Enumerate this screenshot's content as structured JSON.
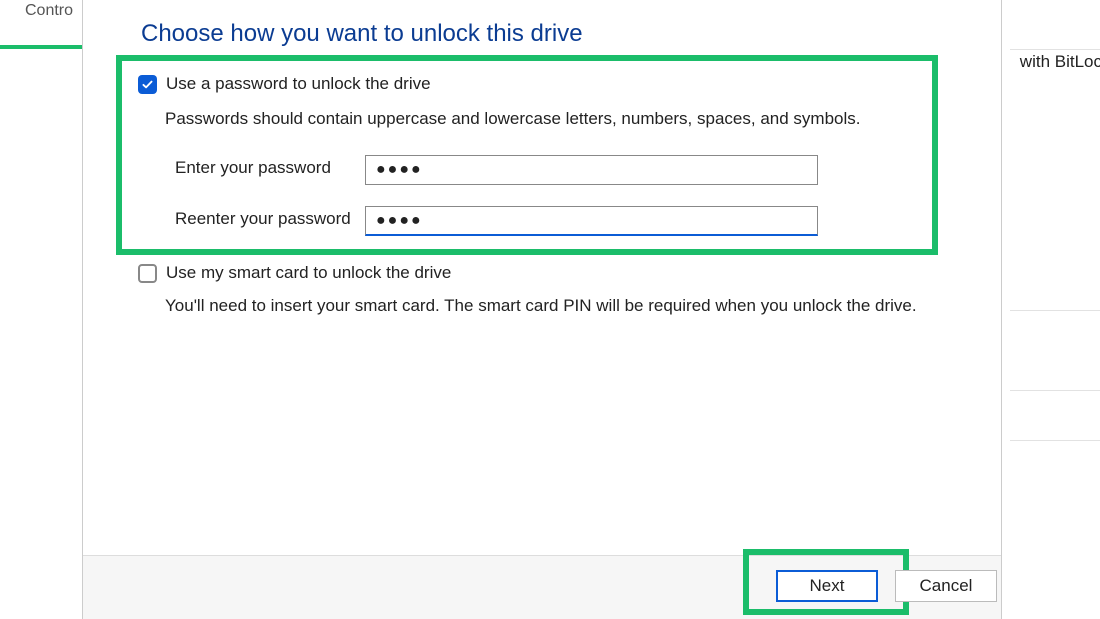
{
  "background": {
    "contro_text": "Contro",
    "bitlock_text": "with BitLoc"
  },
  "dialog": {
    "title": "Choose how you want to unlock this drive",
    "option1": {
      "label": "Use a password to unlock the drive",
      "description": "Passwords should contain uppercase and lowercase letters, numbers, spaces, and symbols.",
      "checked": true,
      "enter_label": "Enter your password",
      "reenter_label": "Reenter your password",
      "enter_value": "●●●●",
      "reenter_value": "●●●●"
    },
    "option2": {
      "label": "Use my smart card to unlock the drive",
      "description": "You'll need to insert your smart card. The smart card PIN will be required when you unlock the drive.",
      "checked": false
    },
    "buttons": {
      "next": "Next",
      "cancel": "Cancel"
    }
  }
}
